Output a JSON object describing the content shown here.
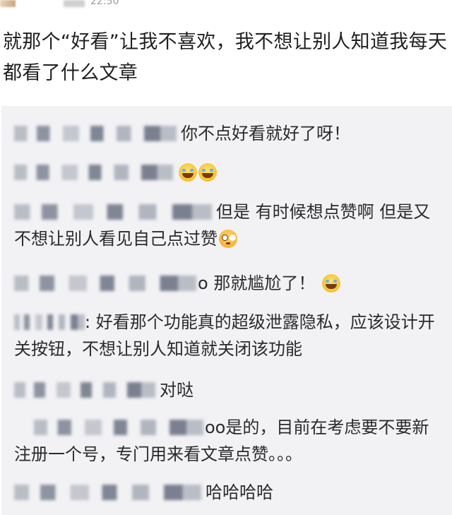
{
  "status_bar": {
    "time": "22:50"
  },
  "post": {
    "text": "就那个“好看”让我不喜欢，我不想让别人知道我每天都看了什么文章"
  },
  "comments": [
    {
      "user_suffix": "",
      "text": "你不点好看就好了呀！",
      "emojis": []
    },
    {
      "user_suffix": "",
      "text": "",
      "emojis": [
        "laughing-crying-emoji",
        "laughing-crying-emoji"
      ]
    },
    {
      "user_suffix": "",
      "text": "但是 有时候想点赞啊 但是又不想让别人看见自己点过赞",
      "emojis": [
        "flushed-emoji"
      ]
    },
    {
      "user_suffix": "o",
      "text": "那就尴尬了！",
      "emojis": [
        "laughing-crying-emoji"
      ]
    },
    {
      "user_suffix": "",
      "text": ": 好看那个功能真的超级泄露隐私，应该设计开关按钮，不想让别人知道就关闭该功能",
      "emojis": []
    },
    {
      "user_suffix": "",
      "text": "对哒",
      "emojis": []
    },
    {
      "user_suffix": "oo",
      "text": "是的，目前在考虑要不要新注册一个号，专门用来看文章点赞。。。",
      "emojis": []
    },
    {
      "user_suffix": "",
      "text": "哈哈哈哈",
      "emojis": []
    }
  ]
}
